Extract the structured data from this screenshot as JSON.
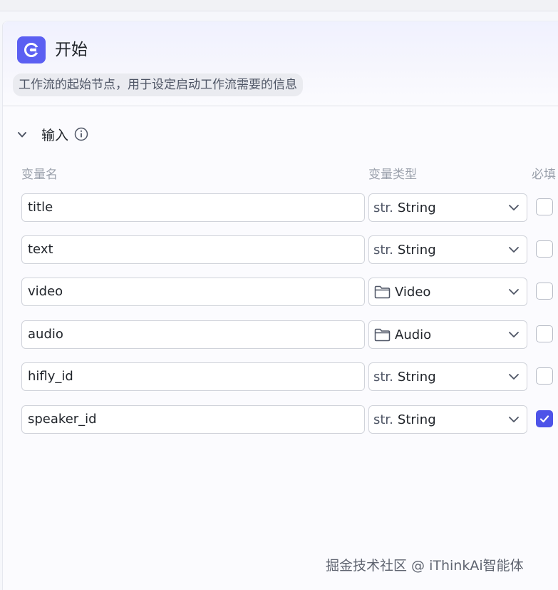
{
  "node": {
    "title": "开始",
    "description": "工作流的起始节点，用于设定启动工作流需要的信息",
    "icon": "start-node-icon",
    "accent_color": "#5b5ff2"
  },
  "section": {
    "title": "输入",
    "info_icon": "info-circle-icon",
    "collapse_icon": "chevron-down-icon"
  },
  "columns": {
    "name": "变量名",
    "type": "变量类型",
    "required": "必填"
  },
  "variables": [
    {
      "name": "title",
      "type_prefix": "str.",
      "type_label": "String",
      "type_icon": "text",
      "required": false
    },
    {
      "name": "text",
      "type_prefix": "str.",
      "type_label": "String",
      "type_icon": "text",
      "required": false
    },
    {
      "name": "video",
      "type_prefix": "",
      "type_label": "Video",
      "type_icon": "folder-icon",
      "required": false
    },
    {
      "name": "audio",
      "type_prefix": "",
      "type_label": "Audio",
      "type_icon": "folder-icon",
      "required": false
    },
    {
      "name": "hifly_id",
      "type_prefix": "str.",
      "type_label": "String",
      "type_icon": "text",
      "required": false
    },
    {
      "name": "speaker_id",
      "type_prefix": "str.",
      "type_label": "String",
      "type_icon": "text",
      "required": true
    }
  ],
  "checkbox_checked_color": "#4d53e8",
  "watermark": "掘金技术社区 @ iThinkAi智能体"
}
